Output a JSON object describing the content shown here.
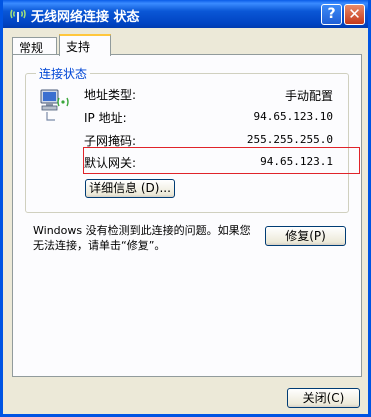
{
  "window": {
    "title": "无线网络连接 状态",
    "help_label": "?",
    "close_label": "✕"
  },
  "tabs": [
    {
      "label": "常规",
      "active": false
    },
    {
      "label": "支持",
      "active": true
    }
  ],
  "connection_status": {
    "legend": "连接状态",
    "rows": [
      {
        "label": "地址类型:",
        "value": "手动配置"
      },
      {
        "label": "IP 地址:",
        "value": "94.65.123.10"
      },
      {
        "label": "子网掩码:",
        "value": "255.255.255.0"
      },
      {
        "label": "默认网关:",
        "value": "94.65.123.1"
      }
    ],
    "details_button": "详细信息 (D)..."
  },
  "repair": {
    "message": "Windows 没有检测到此连接的问题。如果您无法连接，请单击“修复”。",
    "button": "修复(P)"
  },
  "footer": {
    "close_button": "关闭(C)"
  },
  "colors": {
    "titlebar": "#0054e3",
    "highlight_box": "#e0242a",
    "legend_text": "#0046d5"
  }
}
